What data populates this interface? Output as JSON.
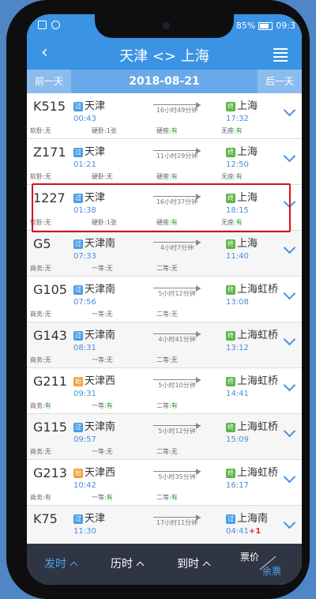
{
  "status": {
    "battery": "85%",
    "time": "09:3"
  },
  "header": {
    "back_icon": "back-chevron-icon",
    "title": "天津 <> 上海",
    "menu_icon": "filter-list-icon"
  },
  "datebar": {
    "prev": "前一天",
    "date": "2018-08-21",
    "next": "后一天"
  },
  "trains": [
    {
      "no": "K515",
      "from": "天津",
      "from_type": "过",
      "dep": "00:43",
      "duration": "16小时49分钟",
      "to": "上海",
      "to_type": "终",
      "arr": "17:32",
      "arr_plus": "",
      "seats": [
        {
          "label": "软卧:",
          "val": "无"
        },
        {
          "label": "硬卧:",
          "val": "1张"
        },
        {
          "label": "硬座:",
          "val": "有"
        },
        {
          "label": "无座:",
          "val": "有"
        }
      ]
    },
    {
      "no": "Z171",
      "from": "天津",
      "from_type": "过",
      "dep": "01:21",
      "duration": "11小时29分钟",
      "to": "上海",
      "to_type": "终",
      "arr": "12:50",
      "arr_plus": "",
      "seats": [
        {
          "label": "软卧:",
          "val": "无"
        },
        {
          "label": "硬卧:",
          "val": "无"
        },
        {
          "label": "硬座:",
          "val": "有"
        },
        {
          "label": "无座:",
          "val": "有"
        }
      ]
    },
    {
      "no": "1227",
      "from": "天津",
      "from_type": "过",
      "dep": "01:38",
      "duration": "16小时37分钟",
      "to": "上海",
      "to_type": "终",
      "arr": "18:15",
      "arr_plus": "",
      "seats": [
        {
          "label": "软卧:",
          "val": "无"
        },
        {
          "label": "硬卧:",
          "val": "1张"
        },
        {
          "label": "硬座:",
          "val": "有"
        },
        {
          "label": "无座:",
          "val": "有"
        }
      ]
    },
    {
      "no": "G5",
      "from": "天津南",
      "from_type": "过",
      "dep": "07:33",
      "duration": "4小时7分钟",
      "to": "上海",
      "to_type": "终",
      "arr": "11:40",
      "arr_plus": "",
      "seats": [
        {
          "label": "商务:",
          "val": "无"
        },
        {
          "label": "一等:",
          "val": "无"
        },
        {
          "label": "二等:",
          "val": "无"
        },
        {
          "label": "",
          "val": ""
        }
      ]
    },
    {
      "no": "G105",
      "from": "天津南",
      "from_type": "过",
      "dep": "07:56",
      "duration": "5小时12分钟",
      "to": "上海虹桥",
      "to_type": "终",
      "arr": "13:08",
      "arr_plus": "",
      "seats": [
        {
          "label": "商务:",
          "val": "无"
        },
        {
          "label": "一等:",
          "val": "无"
        },
        {
          "label": "二等:",
          "val": "无"
        },
        {
          "label": "",
          "val": ""
        }
      ]
    },
    {
      "no": "G143",
      "from": "天津南",
      "from_type": "过",
      "dep": "08:31",
      "duration": "4小时41分钟",
      "to": "上海虹桥",
      "to_type": "终",
      "arr": "13:12",
      "arr_plus": "",
      "seats": [
        {
          "label": "商务:",
          "val": "无"
        },
        {
          "label": "一等:",
          "val": "无"
        },
        {
          "label": "二等:",
          "val": "无"
        },
        {
          "label": "",
          "val": ""
        }
      ]
    },
    {
      "no": "G211",
      "from": "天津西",
      "from_type": "始",
      "dep": "09:31",
      "duration": "5小时10分钟",
      "to": "上海虹桥",
      "to_type": "终",
      "arr": "14:41",
      "arr_plus": "",
      "seats": [
        {
          "label": "商务:",
          "val": "有"
        },
        {
          "label": "一等:",
          "val": "有"
        },
        {
          "label": "二等:",
          "val": "有"
        },
        {
          "label": "",
          "val": ""
        }
      ]
    },
    {
      "no": "G115",
      "from": "天津南",
      "from_type": "过",
      "dep": "09:57",
      "duration": "5小时12分钟",
      "to": "上海虹桥",
      "to_type": "终",
      "arr": "15:09",
      "arr_plus": "",
      "seats": [
        {
          "label": "商务:",
          "val": "无"
        },
        {
          "label": "一等:",
          "val": "无"
        },
        {
          "label": "二等:",
          "val": "无"
        },
        {
          "label": "",
          "val": ""
        }
      ]
    },
    {
      "no": "G213",
      "from": "天津西",
      "from_type": "始",
      "dep": "10:42",
      "duration": "5小时35分钟",
      "to": "上海虹桥",
      "to_type": "终",
      "arr": "16:17",
      "arr_plus": "",
      "seats": [
        {
          "label": "商务:",
          "val": "有"
        },
        {
          "label": "一等:",
          "val": "有"
        },
        {
          "label": "二等:",
          "val": "有"
        },
        {
          "label": "",
          "val": ""
        }
      ]
    },
    {
      "no": "K75",
      "from": "天津",
      "from_type": "过",
      "dep": "11:30",
      "duration": "17小时11分钟",
      "to": "上海南",
      "to_type": "过",
      "arr": "04:41",
      "arr_plus": "+1",
      "seats": []
    }
  ],
  "bottom": {
    "depart": "发时",
    "duration": "历时",
    "arrive": "到时",
    "price": "票价",
    "remain": "余票"
  },
  "colors": {
    "accent": "#3a93e3",
    "available": "#2a9d2a",
    "highlight": "#d0141a"
  }
}
